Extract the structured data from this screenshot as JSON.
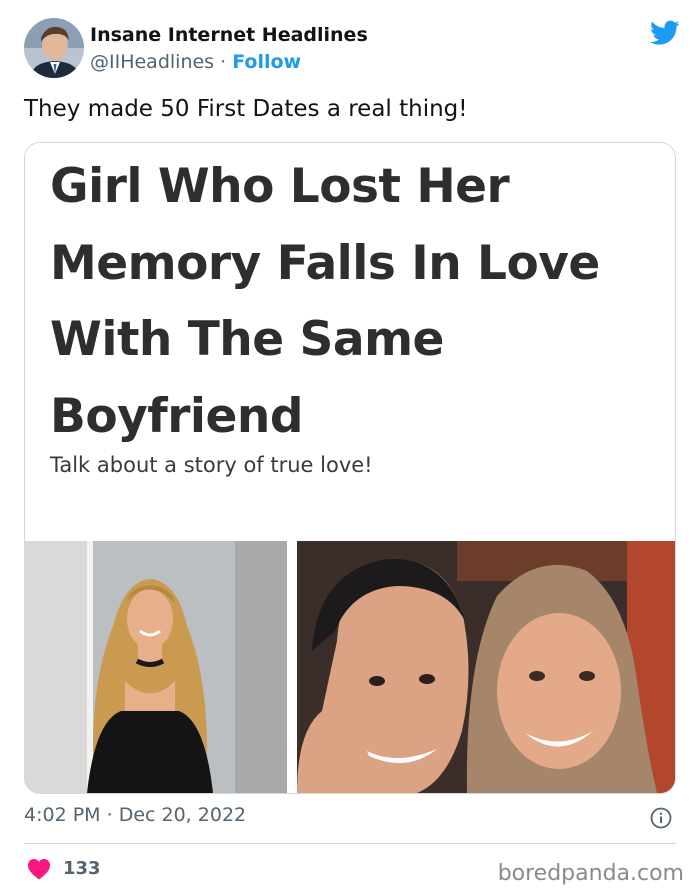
{
  "author": {
    "name": "Insane Internet Headlines",
    "handle": "@IIHeadlines",
    "separator": "·",
    "follow_label": "Follow"
  },
  "tweet": {
    "text": "They made 50 First Dates a real thing!"
  },
  "article": {
    "title": "Girl Who Lost Her Memory Falls In Love With The Same Boyfriend",
    "subtitle": "Talk about a story of true love!"
  },
  "meta": {
    "time": "4:02 PM",
    "separator": "·",
    "date": "Dec 20, 2022"
  },
  "engagement": {
    "likes": "133"
  },
  "watermark": "boredpanda.com",
  "icons": {
    "brand": "twitter-bird-icon",
    "info": "info-icon",
    "like": "heart-icon"
  },
  "colors": {
    "accent": "#1d9bf0",
    "heart": "#f91880",
    "muted": "#536471",
    "border": "#cfd9de"
  }
}
